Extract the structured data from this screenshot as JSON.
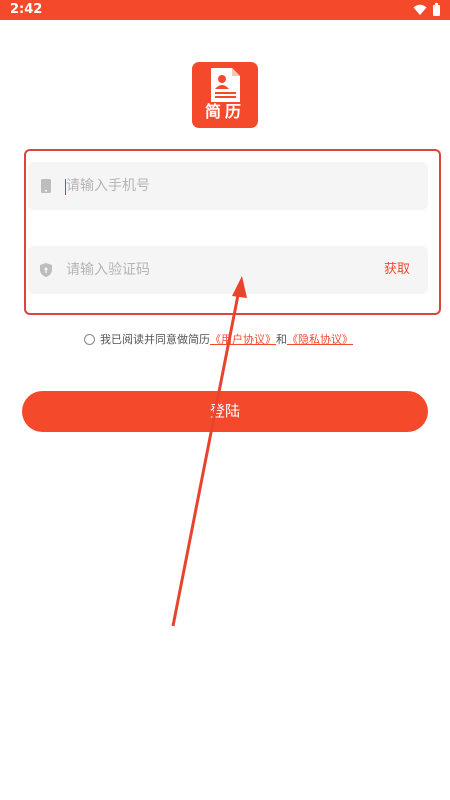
{
  "status_bar": {
    "time": "2:42"
  },
  "logo": {
    "text": "简历"
  },
  "phone_field": {
    "placeholder": "请输入手机号"
  },
  "code_field": {
    "placeholder": "请输入验证码",
    "get_code_label": "获取"
  },
  "agreement": {
    "prefix": "我已阅读并同意做简历",
    "user_agreement": "《用户协议》",
    "conjunction": "和",
    "privacy_agreement": "《隐私协议》"
  },
  "login_button": {
    "label": "登陆"
  },
  "colors": {
    "accent": "#f44a2b",
    "annotation": "#d9463a"
  },
  "icons": [
    "wifi-icon",
    "battery-icon",
    "resume-document-icon",
    "phone-icon",
    "shield-icon",
    "annotation-arrow-icon"
  ]
}
